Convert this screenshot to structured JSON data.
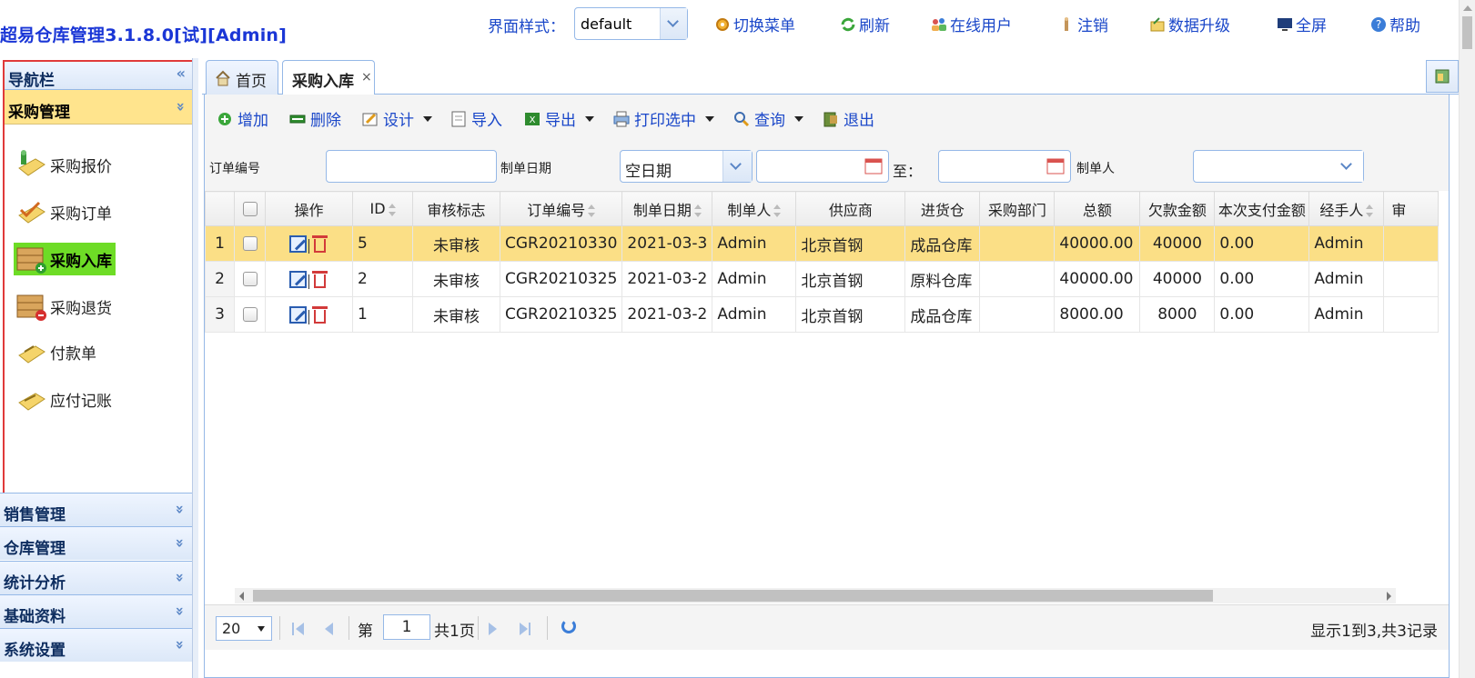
{
  "header": {
    "app_title": "超易仓库管理3.1.8.0[试][Admin]",
    "style_label": "界面样式：",
    "style_value": "default",
    "links": [
      {
        "label": "切换菜单",
        "icon": "gear-icon"
      },
      {
        "label": "刷新",
        "icon": "refresh-icon"
      },
      {
        "label": "在线用户",
        "icon": "users-icon"
      },
      {
        "label": "注销",
        "icon": "logout-icon"
      },
      {
        "label": "数据升级",
        "icon": "upgrade-icon"
      },
      {
        "label": "全屏",
        "icon": "monitor-icon"
      },
      {
        "label": "帮助",
        "icon": "help-icon"
      }
    ]
  },
  "nav": {
    "title": "导航栏",
    "collapse_symbol": "«",
    "active_group": "采购管理",
    "items": [
      {
        "label": "采购报价",
        "icon": "quote-icon"
      },
      {
        "label": "采购订单",
        "icon": "order-icon"
      },
      {
        "label": "采购入库",
        "icon": "stock-in-icon"
      },
      {
        "label": "采购退货",
        "icon": "return-icon"
      },
      {
        "label": "付款单",
        "icon": "payment-icon"
      },
      {
        "label": "应付记账",
        "icon": "ledger-icon"
      }
    ],
    "groups": [
      "销售管理",
      "仓库管理",
      "统计分析",
      "基础资料",
      "系统设置"
    ]
  },
  "tabs": [
    {
      "label": "首页",
      "icon": "home-icon"
    },
    {
      "label": "采购入库",
      "close": "×"
    }
  ],
  "toolbar": {
    "add": "增加",
    "delete": "删除",
    "design": "设计",
    "import": "导入",
    "export": "导出",
    "print": "打印选中",
    "query": "查询",
    "exit": "退出"
  },
  "filter": {
    "order_no_label": "订单编号",
    "order_no_value": "",
    "date_label": "制单日期",
    "date_mode": "空日期",
    "date_from": "",
    "to_label": "至：",
    "date_to": "",
    "maker_label": "制单人",
    "maker_value": ""
  },
  "grid": {
    "columns": [
      "操作",
      "ID",
      "审核标志",
      "订单编号",
      "制单日期",
      "制单人",
      "供应商",
      "进货仓",
      "采购部门",
      "总额",
      "欠款金额",
      "本次支付金额",
      "经手人",
      "审"
    ],
    "rows": [
      {
        "rn": "1",
        "id": "5",
        "status": "未审核",
        "order_no": "CGR20210330",
        "date": "2021-03-3",
        "maker": "Admin",
        "supplier": "北京首钢",
        "warehouse": "成品仓库",
        "dept": "",
        "total": "40000.00",
        "owed": "40000",
        "paid": "0.00",
        "handler": "Admin"
      },
      {
        "rn": "2",
        "id": "2",
        "status": "未审核",
        "order_no": "CGR20210325",
        "date": "2021-03-2",
        "maker": "Admin",
        "supplier": "北京首钢",
        "warehouse": "原料仓库",
        "dept": "",
        "total": "40000.00",
        "owed": "40000",
        "paid": "0.00",
        "handler": "Admin"
      },
      {
        "rn": "3",
        "id": "1",
        "status": "未审核",
        "order_no": "CGR20210325",
        "date": "2021-03-2",
        "maker": "Admin",
        "supplier": "北京首钢",
        "warehouse": "成品仓库",
        "dept": "",
        "total": "8000.00",
        "owed": "8000",
        "paid": "0.00",
        "handler": "Admin"
      }
    ]
  },
  "pager": {
    "page_size": "20",
    "page_prefix": "第",
    "page_value": "1",
    "page_total": "共1页",
    "summary": "显示1到3,共3记录"
  },
  "colors": {
    "accent": "#1a47c9",
    "border": "#95b8e7",
    "highlight_row": "#fbdf86",
    "active_group": "#ffe48d",
    "active_item": "#6edc26",
    "focus_box": "#e03a3a"
  }
}
